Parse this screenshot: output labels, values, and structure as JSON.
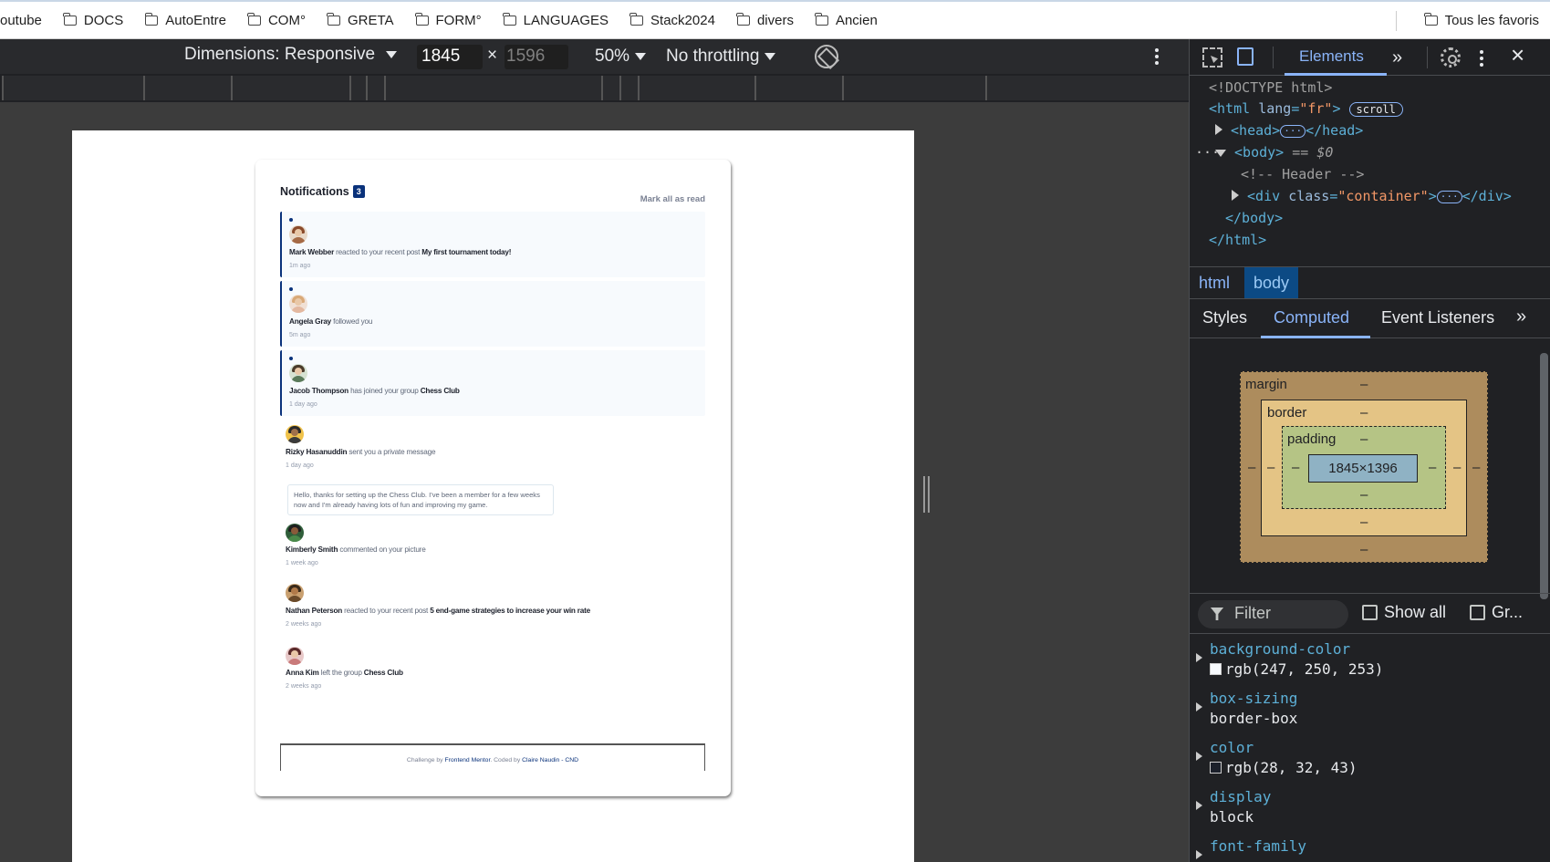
{
  "bookmarks": {
    "items": [
      "outube",
      "DOCS",
      "AutoEntre",
      "COM°",
      "GRETA",
      "FORM°",
      "LANGUAGES",
      "Stack2024",
      "divers",
      "Ancien"
    ],
    "all_bookmarks": "Tous les favoris"
  },
  "device_toolbar": {
    "dimensions_label": "Dimensions: Responsive",
    "width": "1845",
    "times": "×",
    "height": "1596",
    "zoom": "50%",
    "throttling": "No throttling"
  },
  "notifications": {
    "title": "Notifications",
    "count": "3",
    "mark_all": "Mark all as read",
    "items": [
      {
        "name": "Mark Webber",
        "action": "reacted to your recent post",
        "target": "My first tournament today!",
        "time": "1m ago",
        "unread": true
      },
      {
        "name": "Angela Gray",
        "action": "followed you",
        "target": "",
        "time": "5m ago",
        "unread": true
      },
      {
        "name": "Jacob Thompson",
        "action": "has joined your group",
        "target": "Chess Club",
        "time": "1 day ago",
        "unread": true
      },
      {
        "name": "Rizky Hasanuddin",
        "action": "sent you a private message",
        "target": "",
        "time": "1 day ago",
        "unread": false,
        "message": "Hello, thanks for setting up the Chess Club. I've been a member for a few weeks now and I'm already having lots of fun and improving my game."
      },
      {
        "name": "Kimberly Smith",
        "action": "commented on your picture",
        "target": "",
        "time": "1 week ago",
        "unread": false
      },
      {
        "name": "Nathan Peterson",
        "action": "reacted to your recent post",
        "target": "5 end-game strategies to increase your win rate",
        "time": "2 weeks ago",
        "unread": false
      },
      {
        "name": "Anna Kim",
        "action": "left the group",
        "target": "Chess Club",
        "time": "2 weeks ago",
        "unread": false
      }
    ],
    "footer": {
      "challenge": "Challenge by",
      "fm": "Frontend Mentor",
      "coded": ". Coded by",
      "author": "Claire Naudin - CND"
    }
  },
  "devtools": {
    "tabs": {
      "elements": "Elements"
    },
    "dom": {
      "doctype": "<!DOCTYPE html>",
      "html_open": "<html",
      "lang_attr": "lang",
      "lang_val": "\"fr\"",
      "close": ">",
      "scroll_badge": "scroll",
      "head": "<head>",
      "head_close": "</head>",
      "body": "<body>",
      "body_eq": "== $0",
      "comment": "<!-- Header -->",
      "div_open": "<div",
      "class_attr": "class",
      "class_val": "\"container\"",
      "div_close": "</div>",
      "body_close": "</body>",
      "html_close": "</html>"
    },
    "breadcrumbs": [
      "html",
      "body"
    ],
    "subtabs": [
      "Styles",
      "Computed",
      "Event Listeners"
    ],
    "box_model": {
      "margin": "margin",
      "border": "border",
      "padding": "padding",
      "content": "1845×1396",
      "dash": "–"
    },
    "filter": {
      "placeholder": "Filter",
      "show_all": "Show all",
      "group": "Gr..."
    },
    "properties": [
      {
        "name": "background-color",
        "value": "rgb(247, 250, 253)",
        "swatch": "#f7fafd"
      },
      {
        "name": "box-sizing",
        "value": "border-box"
      },
      {
        "name": "color",
        "value": "rgb(28, 32, 43)",
        "swatch": "#1c202b"
      },
      {
        "name": "display",
        "value": "block"
      },
      {
        "name": "font-family",
        "value": ""
      }
    ]
  }
}
